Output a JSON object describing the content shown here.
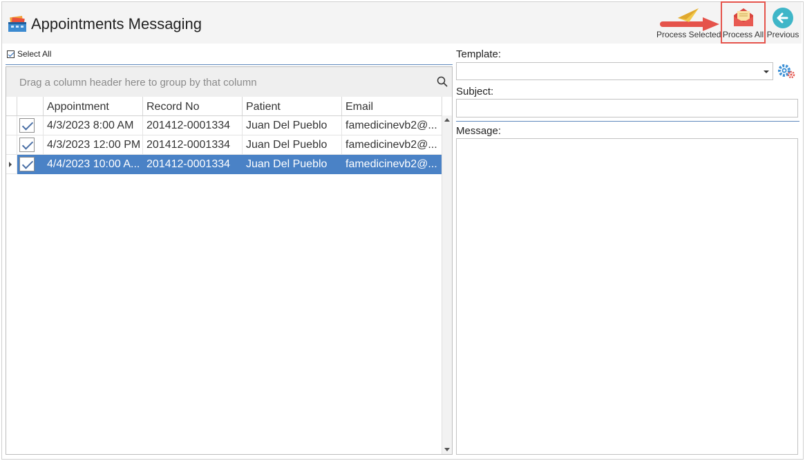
{
  "window": {
    "title": "Appointments Messaging"
  },
  "toolbar": {
    "process_selected_label": "Process Selected",
    "process_all_label": "Process All",
    "previous_label": "Previous",
    "accent_highlight": "#e5534b"
  },
  "list": {
    "select_all_label": "Select All",
    "select_all_checked": true,
    "group_panel_text": "Drag a column header here to group by that column",
    "columns": [
      "Appointment",
      "Record No",
      "Patient",
      "Email"
    ],
    "rows": [
      {
        "checked": true,
        "appointment": "4/3/2023 8:00 AM",
        "record_no": "201412-0001334",
        "patient": "Juan Del Pueblo",
        "email": "famedicinevb2@...",
        "selected": false
      },
      {
        "checked": true,
        "appointment": "4/3/2023 12:00 PM",
        "record_no": "201412-0001334",
        "patient": "Juan Del Pueblo",
        "email": "famedicinevb2@...",
        "selected": false
      },
      {
        "checked": true,
        "appointment": "4/4/2023 10:00 A...",
        "record_no": "201412-0001334",
        "patient": "Juan Del Pueblo",
        "email": "famedicinevb2@...",
        "selected": true
      }
    ],
    "selection_color": "#4a82c6"
  },
  "form": {
    "template_label": "Template:",
    "template_value": "",
    "subject_label": "Subject:",
    "subject_value": "",
    "message_label": "Message:",
    "message_value": ""
  },
  "icons": {
    "app": "appointments-icon",
    "process_selected": "paper-plane-icon",
    "process_all": "open-envelope-icon",
    "previous": "back-arrow-icon",
    "search": "search-icon",
    "settings": "gear-icon"
  }
}
